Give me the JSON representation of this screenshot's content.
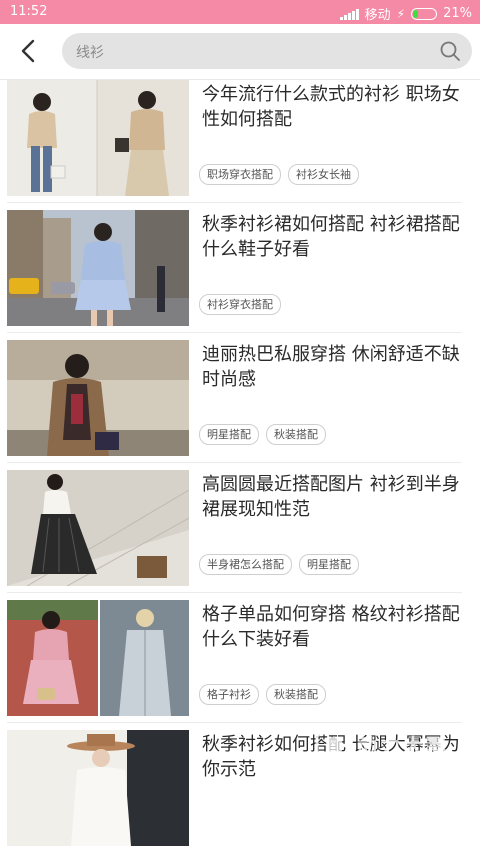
{
  "status_bar": {
    "time": "11:52",
    "carrier": "移动",
    "battery_text": "21%",
    "battery_level": 0.21,
    "signal_icon": "signal-icon",
    "charging_icon": "bolt-icon"
  },
  "header": {
    "back_icon": "back-arrow-icon",
    "search": {
      "value": "线衫",
      "icon": "search-icon"
    }
  },
  "colors": {
    "status_bar": "#f48aa6",
    "search_bg": "#e3e3e3",
    "battery_fill": "#3ee03e"
  },
  "feed": {
    "items": [
      {
        "title": "今年流行什么款式的衬衫 职场女性如何搭配",
        "tags": [
          "职场穿衣搭配",
          "衬衫女长袖"
        ]
      },
      {
        "title": "秋季衬衫裙如何搭配 衬衫裙搭配什么鞋子好看",
        "tags": [
          "衬衫穿衣搭配"
        ]
      },
      {
        "title": "迪丽热巴私服穿搭 休闲舒适不缺时尚感",
        "tags": [
          "明星搭配",
          "秋装搭配"
        ]
      },
      {
        "title": "高圆圆最近搭配图片 衬衫到半身裙展现知性范",
        "tags": [
          "半身裙怎么搭配",
          "明星搭配"
        ]
      },
      {
        "title": "格子单品如何穿搭 格纹衬衫搭配什么下装好看",
        "tags": [
          "格子衬衫",
          "秋装搭配"
        ]
      },
      {
        "title": "秋季衬衫如何搭配 长腿大幂幂为你示范",
        "tags": []
      }
    ]
  },
  "watermark": {
    "text": "动力大幂",
    "sub": "YING JIAN ZHI JIA.COM"
  }
}
